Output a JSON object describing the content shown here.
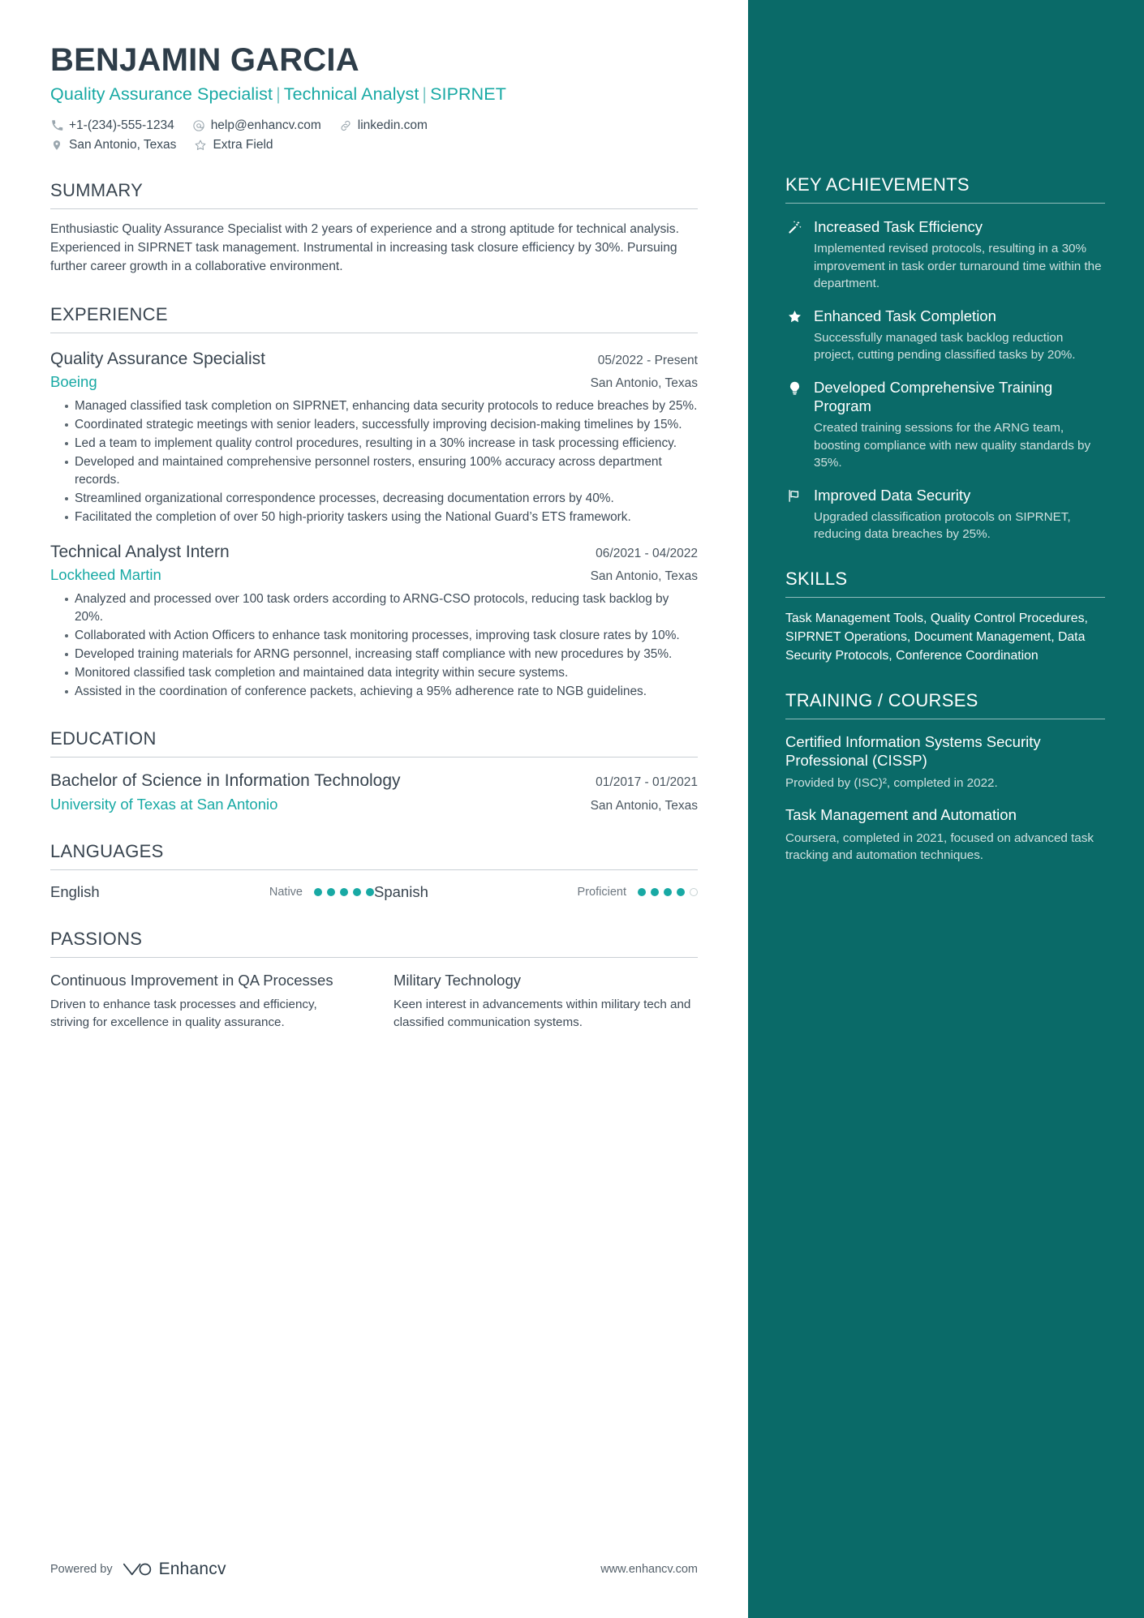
{
  "header": {
    "name": "BENJAMIN GARCIA",
    "headline_parts": [
      "Quality Assurance Specialist",
      "Technical Analyst",
      "SIPRNET"
    ],
    "separator": "|",
    "contacts_row1": [
      {
        "icon": "phone-icon",
        "text": "+1-(234)-555-1234"
      },
      {
        "icon": "email-icon",
        "text": "help@enhancv.com"
      },
      {
        "icon": "link-icon",
        "text": "linkedin.com"
      }
    ],
    "contacts_row2": [
      {
        "icon": "location-pin-icon",
        "text": "San Antonio, Texas"
      },
      {
        "icon": "star-outline-icon",
        "text": "Extra Field"
      }
    ]
  },
  "summary": {
    "title": "SUMMARY",
    "text": "Enthusiastic Quality Assurance Specialist with 2 years of experience and a strong aptitude for technical analysis. Experienced in SIPRNET task management. Instrumental in increasing task closure efficiency by 30%. Pursuing further career growth in a collaborative environment."
  },
  "experience": {
    "title": "EXPERIENCE",
    "jobs": [
      {
        "title": "Quality Assurance Specialist",
        "dates": "05/2022 - Present",
        "company": "Boeing",
        "location": "San Antonio, Texas",
        "bullets": [
          "Managed classified task completion on SIPRNET, enhancing data security protocols to reduce breaches by 25%.",
          "Coordinated strategic meetings with senior leaders, successfully improving decision-making timelines by 15%.",
          "Led a team to implement quality control procedures, resulting in a 30% increase in task processing efficiency.",
          "Developed and maintained comprehensive personnel rosters, ensuring 100% accuracy across department records.",
          "Streamlined organizational correspondence processes, decreasing documentation errors by 40%.",
          "Facilitated the completion of over 50 high-priority taskers using the National Guard’s ETS framework."
        ]
      },
      {
        "title": "Technical Analyst Intern",
        "dates": "06/2021 - 04/2022",
        "company": "Lockheed Martin",
        "location": "San Antonio, Texas",
        "bullets": [
          "Analyzed and processed over 100 task orders according to ARNG-CSO protocols, reducing task backlog by 20%.",
          "Collaborated with Action Officers to enhance task monitoring processes, improving task closure rates by 10%.",
          "Developed training materials for ARNG personnel, increasing staff compliance with new procedures by 35%.",
          "Monitored classified task completion and maintained data integrity within secure systems.",
          "Assisted in the coordination of conference packets, achieving a 95% adherence rate to NGB guidelines."
        ]
      }
    ]
  },
  "education": {
    "title": "EDUCATION",
    "entries": [
      {
        "degree": "Bachelor of Science in Information Technology",
        "dates": "01/2017 - 01/2021",
        "school": "University of Texas at San Antonio",
        "location": "San Antonio, Texas"
      }
    ]
  },
  "languages": {
    "title": "LANGUAGES",
    "items": [
      {
        "name": "English",
        "level": "Native",
        "filled": 5,
        "total": 5
      },
      {
        "name": "Spanish",
        "level": "Proficient",
        "filled": 4,
        "total": 5
      }
    ]
  },
  "passions": {
    "title": "PASSIONS",
    "items": [
      {
        "title": "Continuous Improvement in QA Processes",
        "desc": "Driven to enhance task processes and efficiency, striving for excellence in quality assurance."
      },
      {
        "title": "Military Technology",
        "desc": "Keen interest in advancements within military tech and classified communication systems."
      }
    ]
  },
  "footer": {
    "powered_by": "Powered by",
    "brand": "Enhancv",
    "url": "www.enhancv.com"
  },
  "sidebar": {
    "achievements": {
      "title": "KEY ACHIEVEMENTS",
      "items": [
        {
          "icon": "magic-wand-icon",
          "title": "Increased Task Efficiency",
          "desc": "Implemented revised protocols, resulting in a 30% improvement in task order turnaround time within the department."
        },
        {
          "icon": "star-filled-icon",
          "title": "Enhanced Task Completion",
          "desc": "Successfully managed task backlog reduction project, cutting pending classified tasks by 20%."
        },
        {
          "icon": "lightbulb-icon",
          "title": "Developed Comprehensive Training Program",
          "desc": "Created training sessions for the ARNG team, boosting compliance with new quality standards by 35%."
        },
        {
          "icon": "flag-icon",
          "title": "Improved Data Security",
          "desc": "Upgraded classification protocols on SIPRNET, reducing data breaches by 25%."
        }
      ]
    },
    "skills": {
      "title": "SKILLS",
      "text": "Task Management Tools, Quality Control Procedures, SIPRNET Operations, Document Management, Data Security Protocols, Conference Coordination"
    },
    "training": {
      "title": "TRAINING / COURSES",
      "items": [
        {
          "title": "Certified Information Systems Security Professional (CISSP)",
          "desc": "Provided by (ISC)², completed in 2022."
        },
        {
          "title": "Task Management and Automation",
          "desc": "Coursera, completed in 2021, focused on advanced task tracking and automation techniques."
        }
      ]
    }
  },
  "colors": {
    "sidebar_bg": "#0a6a68",
    "accent_teal": "#18a9a4",
    "heading": "#38444f",
    "body_text": "#3e4b57"
  }
}
